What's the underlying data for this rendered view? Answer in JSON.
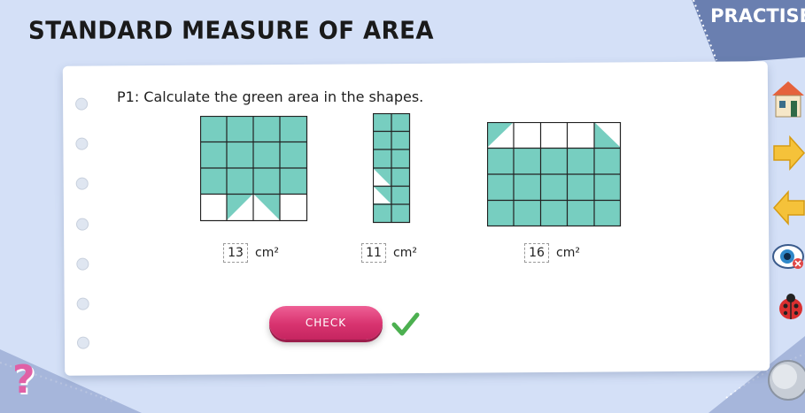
{
  "header": {
    "title": "STANDARD MEASURE OF AREA"
  },
  "banner": {
    "label": "PRACTISE"
  },
  "question": {
    "text": "P1: Calculate the green area in the shapes."
  },
  "answers": [
    {
      "value": "13",
      "unit": "cm²"
    },
    {
      "value": "11",
      "unit": "cm²"
    },
    {
      "value": "16",
      "unit": "cm²"
    }
  ],
  "actions": {
    "check_label": "CHECK"
  },
  "colors": {
    "fill": "#77cec0",
    "accent": "#d8336f",
    "tick": "#4cb050",
    "banner": "#6a7fb0"
  },
  "icons": [
    "home-icon",
    "next-arrow-icon",
    "back-arrow-icon",
    "eye-icon",
    "ladybug-icon",
    "help-icon",
    "tick-icon"
  ]
}
